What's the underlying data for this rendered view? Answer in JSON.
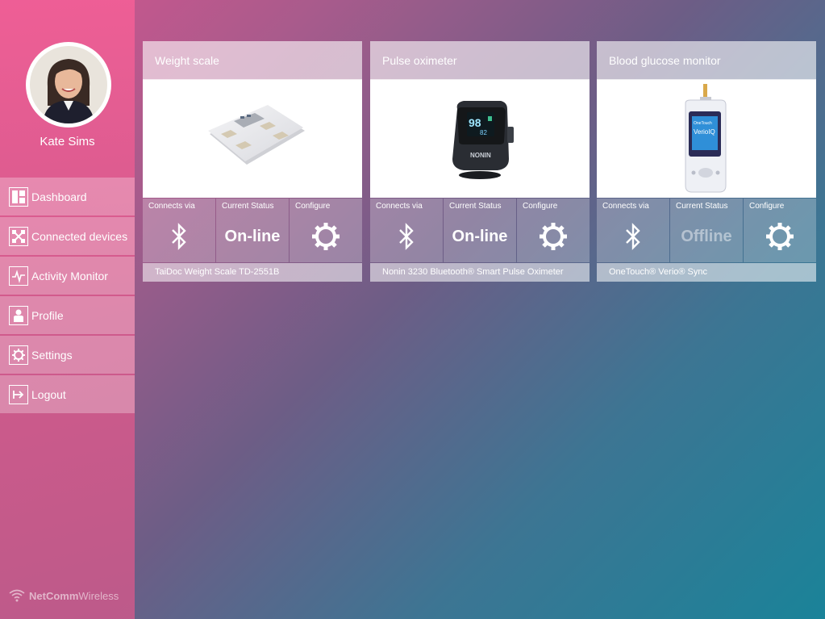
{
  "user": {
    "name": "Kate Sims"
  },
  "nav": [
    {
      "label": "Dashboard",
      "icon": "dashboard-icon"
    },
    {
      "label": "Connected devices",
      "icon": "connected-devices-icon"
    },
    {
      "label": "Activity Monitor",
      "icon": "activity-monitor-icon"
    },
    {
      "label": "Profile",
      "icon": "profile-icon"
    },
    {
      "label": "Settings",
      "icon": "settings-icon"
    },
    {
      "label": "Logout",
      "icon": "logout-icon"
    }
  ],
  "brand": {
    "bold": "NetComm",
    "light": "Wireless"
  },
  "labels": {
    "connects_via": "Connects via",
    "current_status": "Current Status",
    "configure": "Configure"
  },
  "devices": [
    {
      "title": "Weight scale",
      "status": "On-line",
      "model": "TaiDoc Weight Scale TD-2551B",
      "connection": "bluetooth-icon"
    },
    {
      "title": "Pulse oximeter",
      "status": "On-line",
      "model": "Nonin 3230 Bluetooth® Smart Pulse Oximeter",
      "connection": "bluetooth-icon",
      "screen_readout": {
        "spo2": "98",
        "pulse": "82"
      },
      "brand_mark": "NONIN"
    },
    {
      "title": "Blood glucose monitor",
      "status": "Offline",
      "model": "OneTouch® Verio® Sync",
      "connection": "bluetooth-icon",
      "screen_text": {
        "top": "OneTouch",
        "main": "VerioIQ"
      }
    }
  ]
}
